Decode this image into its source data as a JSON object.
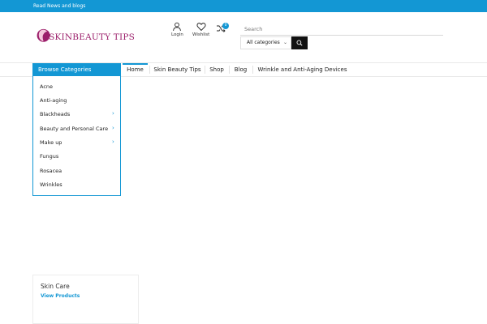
{
  "topbar": {
    "text": "Read News and blogs",
    "color": "#1397d4"
  },
  "logo": {
    "text": "SKINBEAUTY TIPS",
    "color": "#9b1e6a"
  },
  "header": {
    "login": {
      "label": "Login",
      "icon": "user-icon"
    },
    "wishlist": {
      "label": "Wishlist",
      "icon": "heart-icon"
    },
    "compare": {
      "count": "0",
      "icon": "shuffle-icon"
    }
  },
  "search": {
    "placeholder": "Search",
    "category_selected": "All categories",
    "button_icon": "search-icon"
  },
  "nav": {
    "items": [
      {
        "label": "Home"
      },
      {
        "label": "Skin Beauty Tips"
      },
      {
        "label": "Shop"
      },
      {
        "label": "Blog"
      },
      {
        "label": "Wrinkle and Anti-Aging Devices"
      }
    ]
  },
  "categories": {
    "title": "Browse Categories",
    "items": [
      {
        "label": "Acne"
      },
      {
        "label": "Anti-aging"
      },
      {
        "label": "Blackheads",
        "has_children": true
      },
      {
        "label": "Beauty and Personal Care",
        "has_children": true
      },
      {
        "label": "Make up",
        "has_children": true
      },
      {
        "label": "Fungus"
      },
      {
        "label": "Rosacea"
      },
      {
        "label": "Wrinkles"
      }
    ]
  },
  "card": {
    "title": "Skin Care",
    "link": "View Products"
  }
}
